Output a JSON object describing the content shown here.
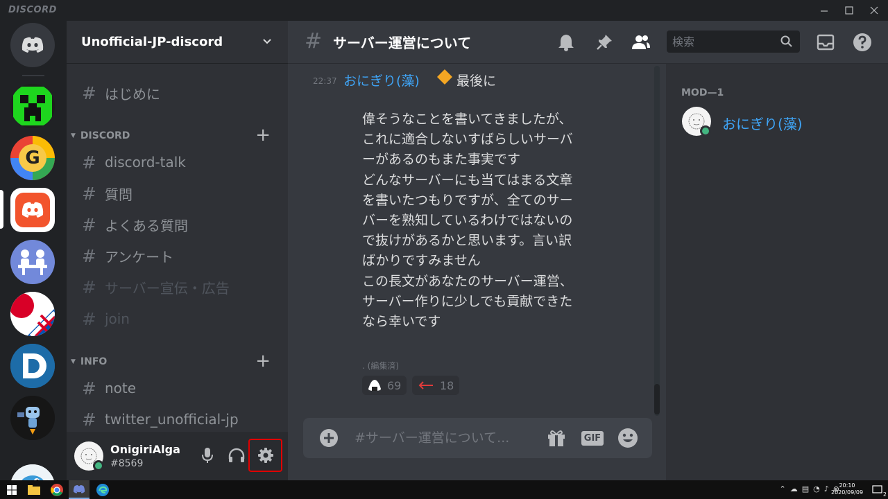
{
  "window": {
    "brand": "DISCORD",
    "controls": [
      "minimize",
      "maximize",
      "close"
    ]
  },
  "servers": [
    {
      "name": "home",
      "icon": "discord-logo-icon"
    },
    {
      "name": "creeper-server",
      "icon": "creeper-icon"
    },
    {
      "name": "g-server",
      "icon": "g-letter-icon",
      "letter": "G"
    },
    {
      "name": "discord-jp-server",
      "icon": "discord-logo-icon",
      "selected": true
    },
    {
      "name": "meeting-server",
      "icon": "people-table-icon"
    },
    {
      "name": "uk-server",
      "icon": "flag-icon"
    },
    {
      "name": "d-server",
      "icon": "d-letter-icon",
      "letter": "D"
    },
    {
      "name": "robot-server",
      "icon": "robot-icon"
    },
    {
      "name": "bird-server",
      "icon": "bird-icon"
    }
  ],
  "sidebar": {
    "guild_name": "Unofficial-JP-discord",
    "top_channels": [
      {
        "name": "はじめに",
        "muted": false
      }
    ],
    "categories": [
      {
        "name": "DISCORD",
        "channels": [
          {
            "name": "discord-talk",
            "muted": false
          },
          {
            "name": "質問",
            "muted": false
          },
          {
            "name": "よくある質問",
            "muted": false
          },
          {
            "name": "アンケート",
            "muted": false
          },
          {
            "name": "サーバー宣伝・広告",
            "muted": true
          },
          {
            "name": "join",
            "muted": true,
            "locked": true
          }
        ]
      },
      {
        "name": "INFO",
        "channels": [
          {
            "name": "note",
            "muted": false
          },
          {
            "name": "twitter_unofficial-jp",
            "muted": false
          }
        ]
      }
    ],
    "user": {
      "name": "OnigiriAlga",
      "discriminator": "#8569",
      "status": "online"
    }
  },
  "chat": {
    "channel_name": "サーバー運営について",
    "search_placeholder": "検索",
    "message": {
      "time": "22:37",
      "author": "おにぎり(藻)",
      "head_text": "最後に",
      "body": "偉そうなことを書いてきましたが、\nこれに適合しないすばらしいサーバ\nーがあるのもまた事実です\nどんなサーバーにも当てはまる文章\nを書いたつもりですが、全てのサー\nバーを熟知しているわけではないの\nで抜けがあるかと思います。言い訳\nばかりですみません\nこの長文があなたのサーバー運営、\nサーバー作りに少しでも貢献できた\nなら幸いです",
      "edited_dot": ".",
      "edited_label": "(編集済)",
      "reactions": [
        {
          "emoji": "onigiri-icon",
          "count": "69"
        },
        {
          "emoji": "left-arrow-icon",
          "count": "18"
        }
      ]
    },
    "composer_placeholder": "#サーバー運営について...",
    "composer_gif": "GIF"
  },
  "members": {
    "role": "MOD—1",
    "list": [
      {
        "name": "おにぎり(藻)",
        "status": "online"
      }
    ]
  },
  "taskbar": {
    "apps": [
      "windows-start-icon",
      "file-explorer-icon",
      "chrome-icon",
      "discord-icon",
      "edge-icon"
    ],
    "clock_time": "20:10",
    "clock_date": "2020/09/09",
    "notification_count": "2"
  },
  "colors": {
    "accent_blue": "#3fa5f7",
    "online_green": "#43b581",
    "highlight_red": "#e00000",
    "blurple": "#7289da"
  }
}
